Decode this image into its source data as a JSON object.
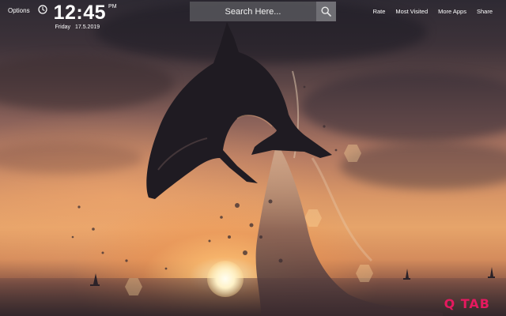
{
  "header": {
    "options_label": "Options",
    "clock": {
      "time": "12:45",
      "ampm": "PM",
      "day": "Friday",
      "date": "17.5.2019"
    }
  },
  "search": {
    "placeholder": "Search Here..."
  },
  "nav": {
    "items": [
      {
        "label": "Rate"
      },
      {
        "label": "Most Visited"
      },
      {
        "label": "More Apps"
      },
      {
        "label": "Share"
      }
    ]
  },
  "branding": {
    "logo_text": "Q TAB",
    "logo_color": "#e5195f"
  },
  "icons": {
    "clock": "clock-icon",
    "search": "search-icon"
  }
}
